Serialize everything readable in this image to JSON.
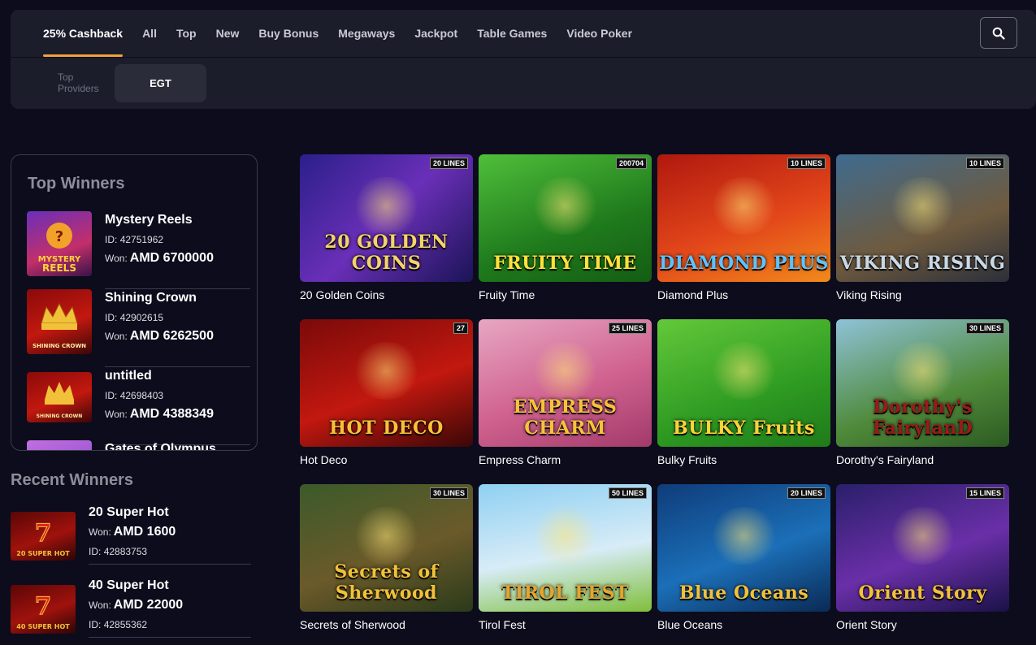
{
  "tabs": [
    "25% Cashback",
    "All",
    "Top",
    "New",
    "Buy Bonus",
    "Megaways",
    "Jackpot",
    "Table Games",
    "Video Poker"
  ],
  "providers": {
    "label": "Top Providers",
    "items": [
      "EGT"
    ]
  },
  "top_winners": {
    "title": "Top Winners",
    "id_label": "ID:",
    "won_label": "Won:",
    "items": [
      {
        "name": "Mystery Reels",
        "id": "42751962",
        "amount": "AMD 6700000",
        "thumb_text": "MYSTERY REELS"
      },
      {
        "name": "Shining Crown",
        "id": "42902615",
        "amount": "AMD 6262500",
        "thumb_text": "SHINING CROWN"
      },
      {
        "name": "untitled",
        "id": "42698403",
        "amount": "AMD 4388349",
        "thumb_text": "SHINING CROWN"
      },
      {
        "name": "Gates of Olympus",
        "id": "",
        "amount": "",
        "thumb_text": ""
      }
    ]
  },
  "recent_winners": {
    "title": "Recent Winners",
    "items": [
      {
        "name": "20 Super Hot",
        "amount": "AMD 1600",
        "id": "42883753",
        "thumb_text": "20 SUPER HOT"
      },
      {
        "name": "40 Super Hot",
        "amount": "AMD 22000",
        "id": "42855362",
        "thumb_text": "40 SUPER HOT"
      }
    ]
  },
  "games": [
    {
      "name": "20 Golden Coins",
      "logo": "20 GOLDEN COINS",
      "badge": "20 LINES",
      "bg": "linear-gradient(135deg,#2b1f8a,#6a2fb8 50%,#1b1456)",
      "logo_color": "#f5d36b"
    },
    {
      "name": "Fruity Time",
      "logo": "FRUITY TIME",
      "badge": "200704",
      "bg": "linear-gradient(160deg,#4fbf3a,#1f7a1c 60%,#145d14)",
      "logo_color": "#ffe23a"
    },
    {
      "name": "Diamond Plus",
      "logo": "DIAMOND PLUS",
      "badge": "10 LINES",
      "bg": "linear-gradient(160deg,#b0180f,#e2461a 55%,#f28a1c)",
      "logo_color": "#5ec2ff"
    },
    {
      "name": "Viking Rising",
      "logo": "VIKING RISING",
      "badge": "10 LINES",
      "bg": "linear-gradient(160deg,#3f6b8f,#6e5a3e 60%,#2b2f3a)",
      "logo_color": "#c9d8e6"
    },
    {
      "name": "Hot Deco",
      "logo": "HOT DECO",
      "badge": "27",
      "bg": "linear-gradient(160deg,#7a0a0a,#c2180f 55%,#3a0707)",
      "logo_color": "#f7c23a"
    },
    {
      "name": "Empress Charm",
      "logo": "EMPRESS CHARM",
      "badge": "25 LINES",
      "bg": "linear-gradient(160deg,#e7a7c3,#d0628f 55%,#a23a6a)",
      "logo_color": "#f7c23a"
    },
    {
      "name": "Bulky Fruits",
      "logo": "BULKY Fruits",
      "badge": "",
      "bg": "linear-gradient(160deg,#63c83a,#2e9b22 60%,#1f7a1a)",
      "logo_color": "#ffd23a"
    },
    {
      "name": "Dorothy's Fairyland",
      "logo": "Dorothy's FairylanD",
      "badge": "30 LINES",
      "bg": "linear-gradient(160deg,#8fc2d8,#4f8a3a 60%,#2c5a22)",
      "logo_color": "#9b1a1a"
    },
    {
      "name": "Secrets of Sherwood",
      "logo": "Secrets of Sherwood",
      "badge": "30 LINES",
      "bg": "linear-gradient(160deg,#3b5a2a,#6b5a2a 55%,#2a3a1a)",
      "logo_color": "#f2c13a"
    },
    {
      "name": "Tirol Fest",
      "logo": "TIROL FEST",
      "badge": "50 LINES",
      "bg": "linear-gradient(170deg,#8fd0f2,#d7ecf7 55%,#7fbf3a)",
      "logo_color": "#e6a52a"
    },
    {
      "name": "Blue Oceans",
      "logo": "Blue Oceans",
      "badge": "20 LINES",
      "bg": "linear-gradient(160deg,#0f3c7a,#1b6fb8 55%,#0a2a55)",
      "logo_color": "#f2c13a"
    },
    {
      "name": "Orient Story",
      "logo": "Orient Story",
      "badge": "15 LINES",
      "bg": "linear-gradient(160deg,#2a1f6a,#6a2fa8 55%,#1a1248)",
      "logo_color": "#f2c13a"
    }
  ],
  "colors": {
    "accent": "#f0a23a",
    "panel": "#1c1d2b",
    "page_bg": "#0c0c1c"
  },
  "icons": {
    "search": "search-icon"
  }
}
